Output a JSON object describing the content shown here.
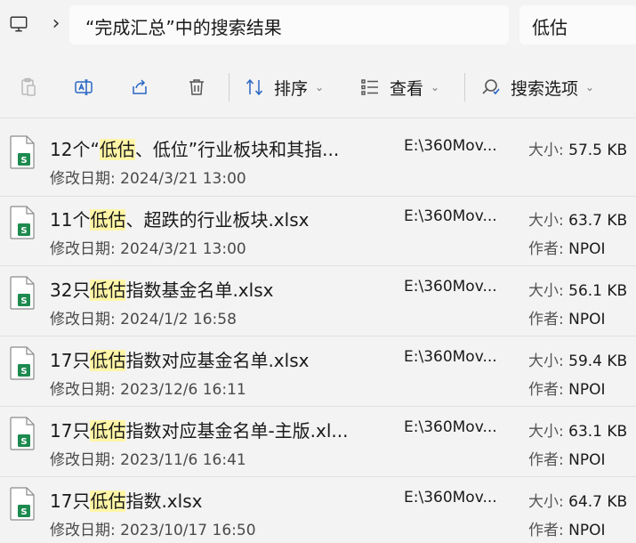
{
  "address": {
    "location": "“完成汇总”中的搜索结果",
    "search_query": "低估"
  },
  "toolbar": {
    "sort_label": "排序",
    "view_label": "查看",
    "search_options_label": "搜索选项"
  },
  "icons": {
    "computer": "computer-icon",
    "paste": "paste-icon",
    "rename": "rename-icon",
    "share": "share-icon",
    "delete": "delete-icon",
    "sort": "sort-icon",
    "view": "view-icon",
    "search_options": "search-options-icon",
    "file": "excel-file-icon"
  },
  "colors": {
    "highlight": "#fff5a6",
    "excel_green": "#1d8a4f"
  },
  "labels": {
    "modified": "修改日期: ",
    "size": "大小: ",
    "author": "作者: "
  },
  "files": [
    {
      "name_pre": "12个“",
      "name_hl": "低估",
      "name_post": "、低位”行业板块和其指...",
      "modified": "2024/3/21 13:00",
      "path": "E:\\360Mov...",
      "size": "57.5 KB",
      "author": ""
    },
    {
      "name_pre": "11个",
      "name_hl": "低估",
      "name_post": "、超跌的行业板块.xlsx",
      "modified": "2024/3/21 13:00",
      "path": "E:\\360Mov...",
      "size": "63.7 KB",
      "author": "NPOI"
    },
    {
      "name_pre": "32只",
      "name_hl": "低估",
      "name_post": "指数基金名单.xlsx",
      "modified": "2024/1/2 16:58",
      "path": "E:\\360Mov...",
      "size": "56.1 KB",
      "author": "NPOI"
    },
    {
      "name_pre": "17只",
      "name_hl": "低估",
      "name_post": "指数对应基金名单.xlsx",
      "modified": "2023/12/6 16:11",
      "path": "E:\\360Mov...",
      "size": "59.4 KB",
      "author": "NPOI"
    },
    {
      "name_pre": "17只",
      "name_hl": "低估",
      "name_post": "指数对应基金名单-主版.xl...",
      "modified": "2023/11/6 16:41",
      "path": "E:\\360Mov...",
      "size": "63.1 KB",
      "author": "NPOI"
    },
    {
      "name_pre": "17只",
      "name_hl": "低估",
      "name_post": "指数.xlsx",
      "modified": "2023/10/17 16:50",
      "path": "E:\\360Mov...",
      "size": "64.7 KB",
      "author": "NPOI"
    }
  ]
}
